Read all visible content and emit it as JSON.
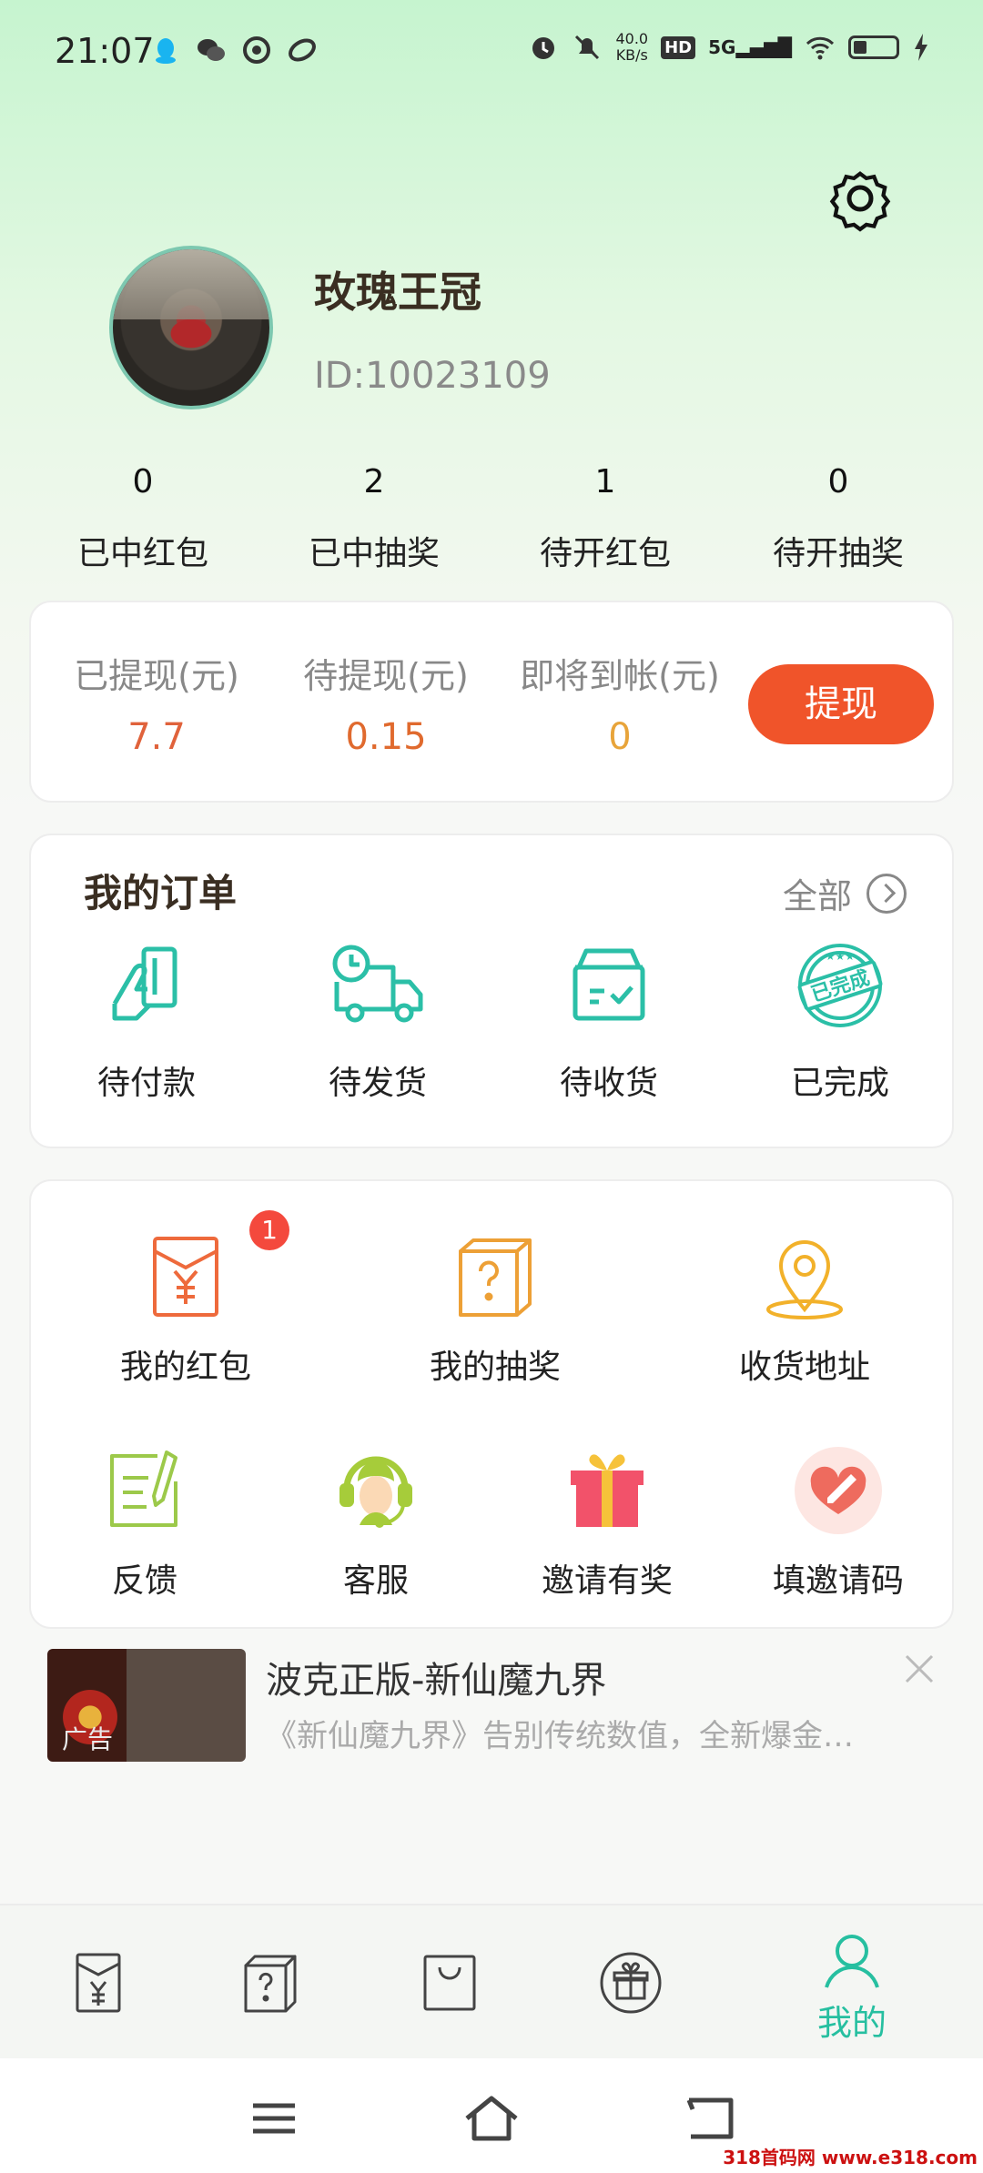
{
  "status_bar": {
    "time": "21:07",
    "net_speed_value": "40.0",
    "net_speed_unit": "KB/s",
    "hd": "HD",
    "signal": "5G",
    "left_icons": [
      "qq-icon",
      "wechat-icon",
      "app-icon",
      "link-icon"
    ],
    "right_icons": [
      "alarm-icon",
      "mute-icon",
      "wifi-icon",
      "battery-icon",
      "charging-icon"
    ]
  },
  "profile": {
    "name": "玫瑰王冠",
    "id_text": "ID:10023109"
  },
  "stats": [
    {
      "value": "0",
      "label": "已中红包"
    },
    {
      "value": "2",
      "label": "已中抽奖"
    },
    {
      "value": "1",
      "label": "待开红包"
    },
    {
      "value": "0",
      "label": "待开抽奖"
    }
  ],
  "wallet": {
    "withdrawn_label": "已提现(元)",
    "withdrawn_value": "7.7",
    "pending_label": "待提现(元)",
    "pending_value": "0.15",
    "arriving_label": "即将到帐(元)",
    "arriving_value": "0",
    "withdraw_button": "提现",
    "colors": {
      "withdrawn": "#e0623b",
      "pending": "#e06a2e",
      "arriving": "#e8a43a",
      "button": "#f0542a"
    }
  },
  "orders": {
    "title": "我的订单",
    "all_label": "全部",
    "items": [
      {
        "label": "待付款",
        "icon": "payment-card-icon"
      },
      {
        "label": "待发货",
        "icon": "delivery-truck-icon"
      },
      {
        "label": "待收货",
        "icon": "package-box-icon"
      },
      {
        "label": "已完成",
        "icon": "completed-stamp-icon",
        "stamp_text": "已完成"
      }
    ]
  },
  "tools": {
    "items": [
      {
        "label": "我的红包",
        "icon": "red-envelope-icon",
        "badge": "1"
      },
      {
        "label": "我的抽奖",
        "icon": "mystery-box-icon"
      },
      {
        "label": "收货地址",
        "icon": "location-pin-icon"
      },
      {
        "label": "反馈",
        "icon": "feedback-note-icon"
      },
      {
        "label": "客服",
        "icon": "customer-service-icon"
      },
      {
        "label": "邀请有奖",
        "icon": "gift-icon"
      },
      {
        "label": "填邀请码",
        "icon": "heart-code-icon"
      }
    ]
  },
  "ad": {
    "title": "波克正版-新仙魔九界",
    "description": "《新仙魔九界》告别传统数值，全新爆金…",
    "tag": "广告"
  },
  "tabbar": {
    "items": [
      {
        "icon": "red-envelope-tab-icon"
      },
      {
        "icon": "lottery-box-tab-icon"
      },
      {
        "icon": "shopping-bag-tab-icon"
      },
      {
        "icon": "gift-tab-icon"
      },
      {
        "icon": "profile-tab-icon",
        "label": "我的",
        "active": true
      }
    ],
    "active_color": "#26bfa0"
  },
  "watermark": "318首码网 www.e318.com"
}
